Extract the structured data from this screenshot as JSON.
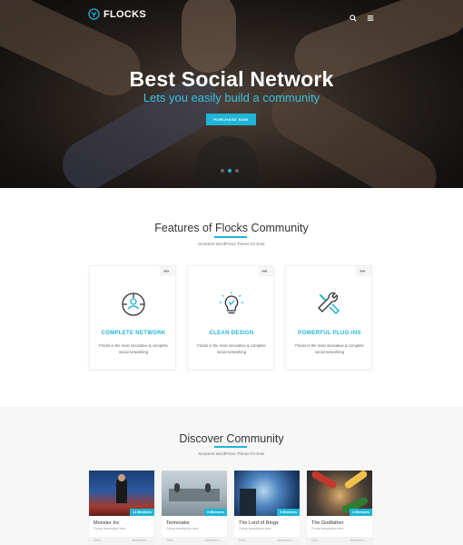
{
  "brand": {
    "name": "FLOCKS"
  },
  "colors": {
    "accent": "#1fb5d6",
    "heroSub": "#36c1e0"
  },
  "hero": {
    "title": "Best Social Network",
    "subtitle": "Lets you easily build a community",
    "button": "PURCHASE NOW",
    "slides": 3,
    "activeSlide": 2
  },
  "features": {
    "title_pre": "Features of ",
    "title_accent": "Flocks",
    "title_post": " Community",
    "subtitle": "Smartest WordPress Theme for Ever",
    "cards": [
      {
        "icon": "network-icon",
        "title": "COMPLETE NETWORK",
        "desc": "Flocks is the most innovative & complete social networking"
      },
      {
        "icon": "lightbulb-icon",
        "title": "CLEAN DESIGN",
        "desc": "Flocks is the most innovative & complete social networking"
      },
      {
        "icon": "tools-icon",
        "title": "POWERFUL PLUG-INS",
        "desc": "Flocks is the most innovative & complete social networking"
      }
    ]
  },
  "discover": {
    "title": "Discover Community",
    "subtitle": "Smartest WordPress Theme for Ever",
    "groups": [
      {
        "name": "Monster Inc",
        "badge": "12 Members",
        "desc": "Group description here",
        "foot_left": "2015",
        "foot_right": "Newsfeed →"
      },
      {
        "name": "Terminator",
        "badge": "8 Members",
        "desc": "Group description here",
        "foot_left": "2015",
        "foot_right": "Newsfeed →"
      },
      {
        "name": "The Lord of Rings",
        "badge": "5 Members",
        "desc": "Group description here",
        "foot_left": "2015",
        "foot_right": "Newsfeed →"
      },
      {
        "name": "The Godfather",
        "badge": "4 Members",
        "desc": "Group description here",
        "foot_left": "2015",
        "foot_right": "Newsfeed →"
      }
    ]
  }
}
